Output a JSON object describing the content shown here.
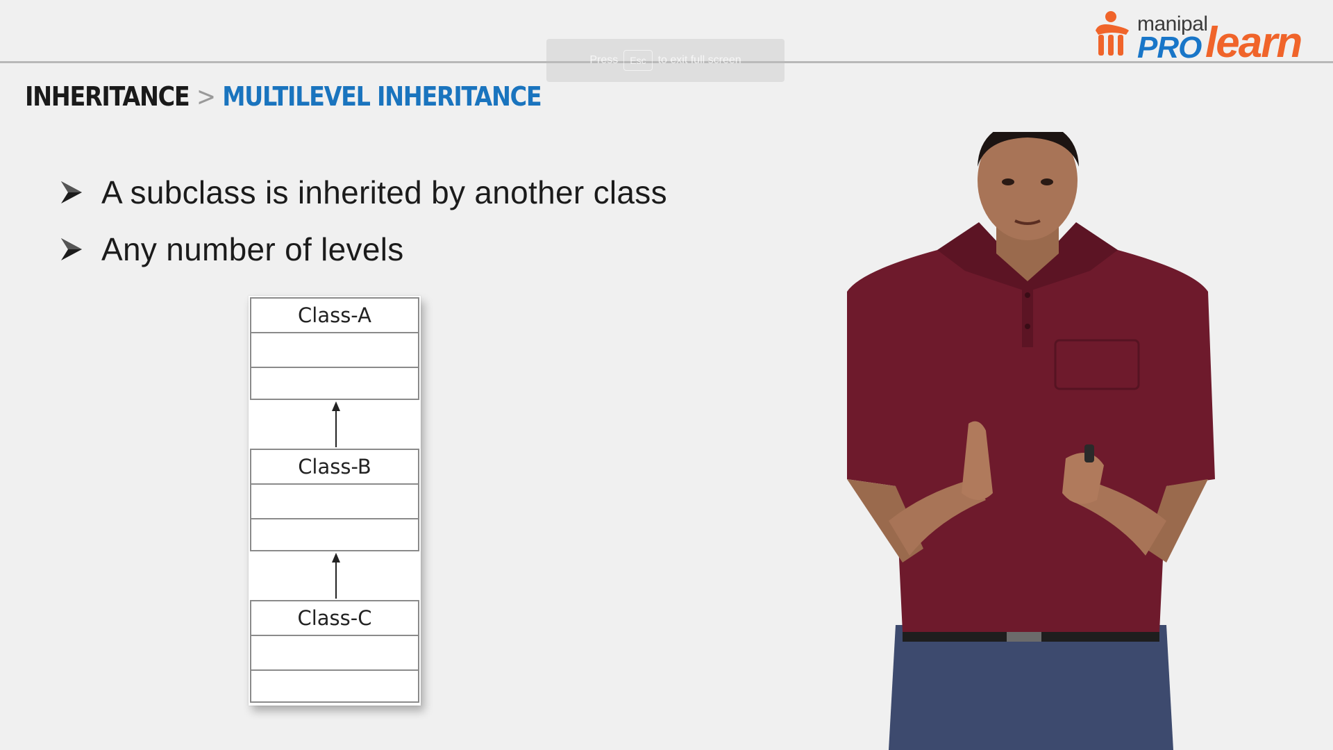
{
  "header": {
    "fullscreen_hint": {
      "before": "Press",
      "key": "Esc",
      "after": "to exit full screen"
    },
    "logo": {
      "small": "manipal",
      "pro": "PRO",
      "learn": "learn",
      "pro_color": "#1976c8",
      "learn_color": "#f0642a"
    }
  },
  "breadcrumb": {
    "parent": "INHERITANCE",
    "separator": ">",
    "current": "MULTILEVEL INHERITANCE",
    "current_color": "#1a74be"
  },
  "bullets": [
    {
      "text": "A subclass is inherited by another class",
      "icon": "arrowhead-bullet-icon"
    },
    {
      "text": "Any number of levels",
      "icon": "arrowhead-bullet-icon"
    }
  ],
  "diagram": {
    "classes": [
      {
        "name": "Class-A"
      },
      {
        "name": "Class-B"
      },
      {
        "name": "Class-C"
      }
    ],
    "relations": [
      {
        "from": "Class-B",
        "to": "Class-A",
        "type": "inherits"
      },
      {
        "from": "Class-C",
        "to": "Class-B",
        "type": "inherits"
      }
    ]
  },
  "presenter": {
    "shirt_color": "#6e1a2c",
    "jeans_color": "#3d4a6e"
  }
}
